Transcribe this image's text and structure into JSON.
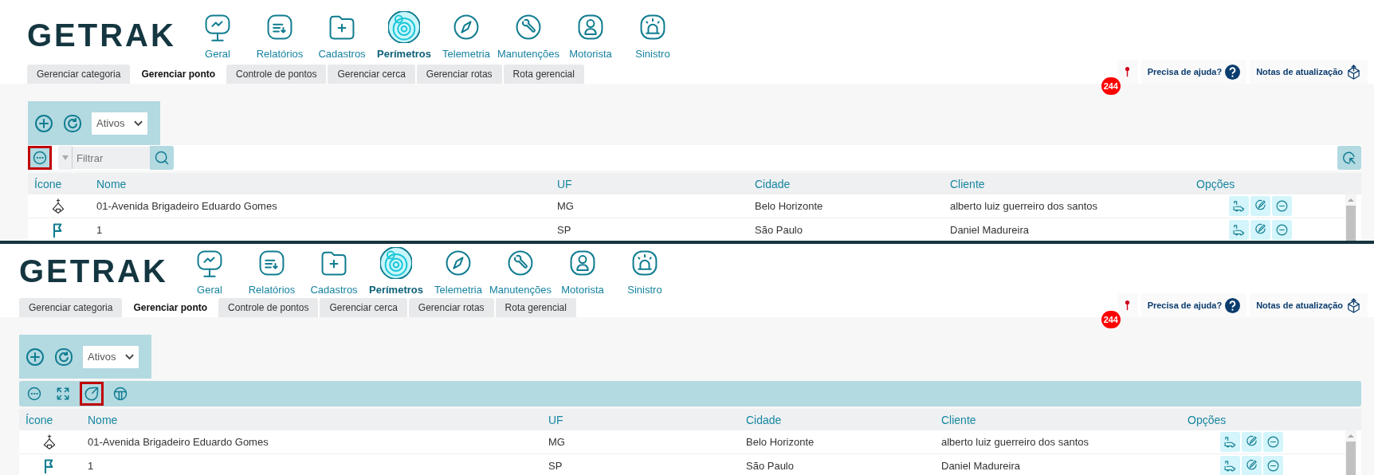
{
  "panels": [
    {
      "logo": "GETRAK",
      "nav": [
        {
          "label": "Geral",
          "kind": "monitor",
          "selected": false
        },
        {
          "label": "Relatórios",
          "kind": "report",
          "selected": false
        },
        {
          "label": "Cadastros",
          "kind": "folder",
          "selected": false
        },
        {
          "label": "Perímetros",
          "kind": "target",
          "selected": true
        },
        {
          "label": "Telemetria",
          "kind": "compass",
          "selected": false
        },
        {
          "label": "Manutenções",
          "kind": "wrench",
          "selected": false
        },
        {
          "label": "Motorista",
          "kind": "driver",
          "selected": false
        },
        {
          "label": "Sinistro",
          "kind": "siren",
          "selected": false
        }
      ],
      "tabs": [
        {
          "label": "Gerenciar categoria",
          "selected": false
        },
        {
          "label": "Gerenciar ponto",
          "selected": true
        },
        {
          "label": "Controle de pontos",
          "selected": false
        },
        {
          "label": "Gerenciar cerca",
          "selected": false
        },
        {
          "label": "Gerenciar rotas",
          "selected": false
        },
        {
          "label": "Rota gerencial",
          "selected": false
        }
      ],
      "badge": "244",
      "help": "Precisa de ajuda?",
      "notes": "Notas de atualização",
      "status_select": "Ativos",
      "tools": [
        {
          "kind": "more",
          "highlighted": true
        }
      ],
      "filter": {
        "placeholder": "Filtrar"
      },
      "columns": [
        "Ícone",
        "Nome",
        "UF",
        "Cidade",
        "Cliente",
        "Opções"
      ],
      "rows": [
        {
          "kind": "house-pin",
          "name": "01-Avenida Brigadeiro Eduardo Gomes",
          "uf": "MG",
          "city": "Belo Horizonte",
          "client": "alberto luiz guerreiro dos santos"
        },
        {
          "kind": "flag",
          "name": "1",
          "uf": "SP",
          "city": "São Paulo",
          "client": "Daniel Madureira"
        }
      ]
    },
    {
      "logo": "GETRAK",
      "nav": [
        {
          "label": "Geral",
          "kind": "monitor",
          "selected": false
        },
        {
          "label": "Relatórios",
          "kind": "report",
          "selected": false
        },
        {
          "label": "Cadastros",
          "kind": "folder",
          "selected": false
        },
        {
          "label": "Perímetros",
          "kind": "target",
          "selected": true
        },
        {
          "label": "Telemetria",
          "kind": "compass",
          "selected": false
        },
        {
          "label": "Manutenções",
          "kind": "wrench",
          "selected": false
        },
        {
          "label": "Motorista",
          "kind": "driver",
          "selected": false
        },
        {
          "label": "Sinistro",
          "kind": "siren",
          "selected": false
        }
      ],
      "tabs": [
        {
          "label": "Gerenciar categoria",
          "selected": false
        },
        {
          "label": "Gerenciar ponto",
          "selected": true
        },
        {
          "label": "Controle de pontos",
          "selected": false
        },
        {
          "label": "Gerenciar cerca",
          "selected": false
        },
        {
          "label": "Gerenciar rotas",
          "selected": false
        },
        {
          "label": "Rota gerencial",
          "selected": false
        }
      ],
      "badge": "244",
      "help": "Precisa de ajuda?",
      "notes": "Notas de atualização",
      "status_select": "Ativos",
      "tools": [
        {
          "kind": "more",
          "highlighted": false
        },
        {
          "kind": "expand",
          "highlighted": false
        },
        {
          "kind": "export",
          "highlighted": true
        },
        {
          "kind": "columns",
          "highlighted": false
        }
      ],
      "columns": [
        "Ícone",
        "Nome",
        "UF",
        "Cidade",
        "Cliente",
        "Opções"
      ],
      "rows": [
        {
          "kind": "house-pin",
          "name": "01-Avenida Brigadeiro Eduardo Gomes",
          "uf": "MG",
          "city": "Belo Horizonte",
          "client": "alberto luiz guerreiro dos santos"
        },
        {
          "kind": "flag",
          "name": "1",
          "uf": "SP",
          "city": "São Paulo",
          "client": "Daniel Madureira"
        }
      ]
    }
  ]
}
